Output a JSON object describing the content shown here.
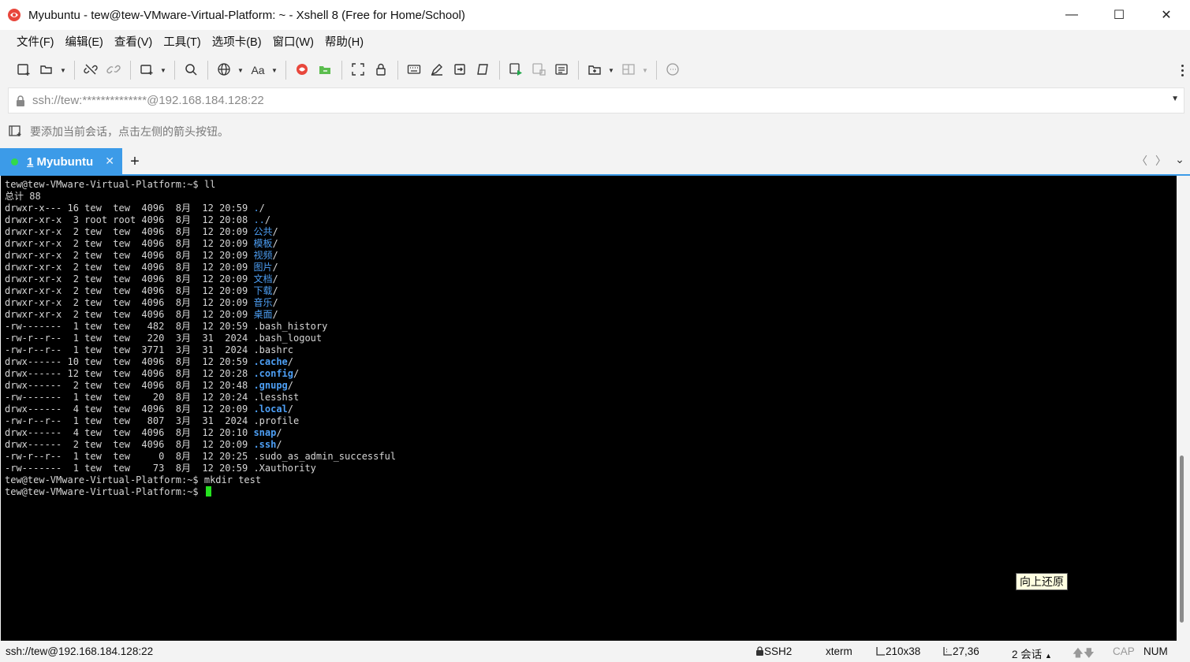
{
  "window": {
    "title": "Myubuntu - tew@tew-VMware-Virtual-Platform: ~ - Xshell 8 (Free for Home/School)",
    "icon": "xshell-icon",
    "minimize_glyph": "—",
    "maximize_glyph": "☐",
    "close_glyph": "✕"
  },
  "menubar": {
    "items": [
      {
        "label": "文件(F)"
      },
      {
        "label": "编辑(E)"
      },
      {
        "label": "查看(V)"
      },
      {
        "label": "工具(T)"
      },
      {
        "label": "选项卡(B)"
      },
      {
        "label": "窗口(W)"
      },
      {
        "label": "帮助(H)"
      }
    ]
  },
  "toolbar": {
    "font_label": "Aa"
  },
  "address": {
    "value": "ssh://tew:**************@192.168.184.128:22",
    "dropdown_glyph": "▼"
  },
  "hint": {
    "text": "要添加当前会话，点击左侧的箭头按钮。"
  },
  "tabs": {
    "active": {
      "number": "1",
      "name": "Myubuntu",
      "close_glyph": "✕"
    },
    "add_glyph": "+",
    "prev_glyph": "〈",
    "next_glyph": "〉",
    "list_glyph": "⌄"
  },
  "terminal": {
    "lines": [
      {
        "prefix": "tew@tew-VMware-Virtual-Platform:~$ ll",
        "name": "",
        "type": "text",
        "suffix": ""
      },
      {
        "prefix": "总计 88",
        "name": "",
        "type": "text",
        "suffix": ""
      },
      {
        "prefix": "drwxr-x--- 16 tew  tew  4096  8月  12 20:59 ",
        "name": ".",
        "type": "dir",
        "suffix": "/"
      },
      {
        "prefix": "drwxr-xr-x  3 root root 4096  8月  12 20:08 ",
        "name": "..",
        "type": "dir",
        "suffix": "/"
      },
      {
        "prefix": "drwxr-xr-x  2 tew  tew  4096  8月  12 20:09 ",
        "name": "公共",
        "type": "dir",
        "suffix": "/"
      },
      {
        "prefix": "drwxr-xr-x  2 tew  tew  4096  8月  12 20:09 ",
        "name": "模板",
        "type": "dir",
        "suffix": "/"
      },
      {
        "prefix": "drwxr-xr-x  2 tew  tew  4096  8月  12 20:09 ",
        "name": "视频",
        "type": "dir",
        "suffix": "/"
      },
      {
        "prefix": "drwxr-xr-x  2 tew  tew  4096  8月  12 20:09 ",
        "name": "图片",
        "type": "dir",
        "suffix": "/"
      },
      {
        "prefix": "drwxr-xr-x  2 tew  tew  4096  8月  12 20:09 ",
        "name": "文档",
        "type": "dir",
        "suffix": "/"
      },
      {
        "prefix": "drwxr-xr-x  2 tew  tew  4096  8月  12 20:09 ",
        "name": "下载",
        "type": "dir",
        "suffix": "/"
      },
      {
        "prefix": "drwxr-xr-x  2 tew  tew  4096  8月  12 20:09 ",
        "name": "音乐",
        "type": "dir",
        "suffix": "/"
      },
      {
        "prefix": "drwxr-xr-x  2 tew  tew  4096  8月  12 20:09 ",
        "name": "桌面",
        "type": "dir",
        "suffix": "/"
      },
      {
        "prefix": "-rw-------  1 tew  tew   482  8月  12 20:59 ",
        "name": ".bash_history",
        "type": "file",
        "suffix": ""
      },
      {
        "prefix": "-rw-r--r--  1 tew  tew   220  3月  31  2024 ",
        "name": ".bash_logout",
        "type": "file",
        "suffix": ""
      },
      {
        "prefix": "-rw-r--r--  1 tew  tew  3771  3月  31  2024 ",
        "name": ".bashrc",
        "type": "file",
        "suffix": ""
      },
      {
        "prefix": "drwx------ 10 tew  tew  4096  8月  12 20:59 ",
        "name": ".cache",
        "type": "dirbold",
        "suffix": "/"
      },
      {
        "prefix": "drwx------ 12 tew  tew  4096  8月  12 20:28 ",
        "name": ".config",
        "type": "dirbold",
        "suffix": "/"
      },
      {
        "prefix": "drwx------  2 tew  tew  4096  8月  12 20:48 ",
        "name": ".gnupg",
        "type": "dirbold",
        "suffix": "/"
      },
      {
        "prefix": "-rw-------  1 tew  tew    20  8月  12 20:24 ",
        "name": ".lesshst",
        "type": "file",
        "suffix": ""
      },
      {
        "prefix": "drwx------  4 tew  tew  4096  8月  12 20:09 ",
        "name": ".local",
        "type": "dirbold",
        "suffix": "/"
      },
      {
        "prefix": "-rw-r--r--  1 tew  tew   807  3月  31  2024 ",
        "name": ".profile",
        "type": "file",
        "suffix": ""
      },
      {
        "prefix": "drwx------  4 tew  tew  4096  8月  12 20:10 ",
        "name": "snap",
        "type": "dirbold",
        "suffix": "/"
      },
      {
        "prefix": "drwx------  2 tew  tew  4096  8月  12 20:09 ",
        "name": ".ssh",
        "type": "dirbold",
        "suffix": "/"
      },
      {
        "prefix": "-rw-r--r--  1 tew  tew     0  8月  12 20:25 ",
        "name": ".sudo_as_admin_successful",
        "type": "file",
        "suffix": ""
      },
      {
        "prefix": "-rw-------  1 tew  tew    73  8月  12 20:59 ",
        "name": ".Xauthority",
        "type": "file",
        "suffix": ""
      },
      {
        "prefix": "tew@tew-VMware-Virtual-Platform:~$ mkdir test",
        "name": "",
        "type": "text",
        "suffix": ""
      },
      {
        "prefix": "tew@tew-VMware-Virtual-Platform:~$ ",
        "name": "",
        "type": "prompt",
        "suffix": ""
      }
    ],
    "colors": {
      "background": "#000000",
      "text": "#d6d6d6",
      "dir": "#4d9ff5",
      "cursor": "#25e21f"
    }
  },
  "tooltip": {
    "text": "向上还原"
  },
  "statusbar": {
    "connection": "ssh://tew@192.168.184.128:22",
    "protocol": "SSH2",
    "terminal_type": "xterm",
    "size": "210x38",
    "cursor_pos": "27,36",
    "sessions": "2 会话",
    "caps": "CAP",
    "num": "NUM"
  },
  "colors": {
    "accent": "#3c9be8",
    "tab_dot": "#33d94b",
    "chrome_bg": "#f3f3f3"
  }
}
